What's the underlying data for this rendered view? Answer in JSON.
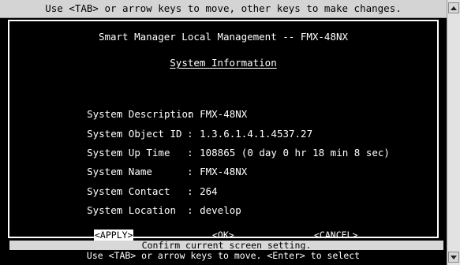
{
  "top_hint": "Use <TAB> or arrow keys to move, other keys to make changes.",
  "header_title": "Smart Manager Local Management -- FMX-48NX",
  "section_title": "System Information",
  "fields": [
    {
      "label": "System Description",
      "value": "FMX-48NX"
    },
    {
      "label": "System Object ID",
      "value": "1.3.6.1.4.1.4537.27"
    },
    {
      "label": "System Up Time",
      "value": "108865 (0 day 0 hr 18 min 8 sec)"
    },
    {
      "label": "System Name",
      "value": "FMX-48NX"
    },
    {
      "label": "System Contact",
      "value": "264"
    },
    {
      "label": "System Location",
      "value": "develop"
    }
  ],
  "separator": ":",
  "buttons": {
    "apply": "<APPLY>",
    "ok": "<OK>",
    "cancel": "<CANCEL>"
  },
  "status_text": "Confirm current screen setting.",
  "bottom_hint": "Use <TAB> or arrow keys to move. <Enter> to select",
  "icons": {
    "scroll_up": "scroll-up-arrow-icon",
    "scroll_down": "scroll-down-arrow-icon"
  }
}
